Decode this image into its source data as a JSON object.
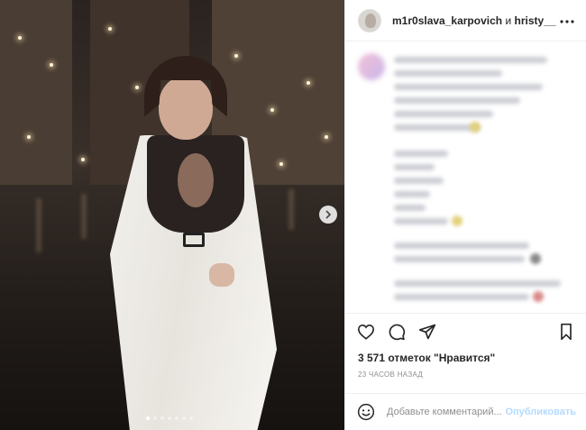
{
  "post": {
    "carousel": {
      "slide_count": 7,
      "active_index": 0
    },
    "header": {
      "author": "m1r0slava_karpovich",
      "conjunction": "и",
      "coauthor": "hristy__"
    },
    "actions": {
      "like_icon": "heart-icon",
      "comment_icon": "comment-icon",
      "share_icon": "paper-plane-icon",
      "save_icon": "bookmark-icon"
    },
    "likes_text": "3 571 отметок \"Нравится\"",
    "timestamp": "23 ЧАСОВ НАЗАД",
    "comment": {
      "placeholder": "Добавьте комментарий...",
      "publish_label": "Опубликовать",
      "emoji_icon": "smiley-icon"
    },
    "colors": {
      "text": "#262626",
      "muted": "#8e8e8e",
      "divider": "#efefef",
      "publish_disabled": "#b3dbff"
    }
  }
}
